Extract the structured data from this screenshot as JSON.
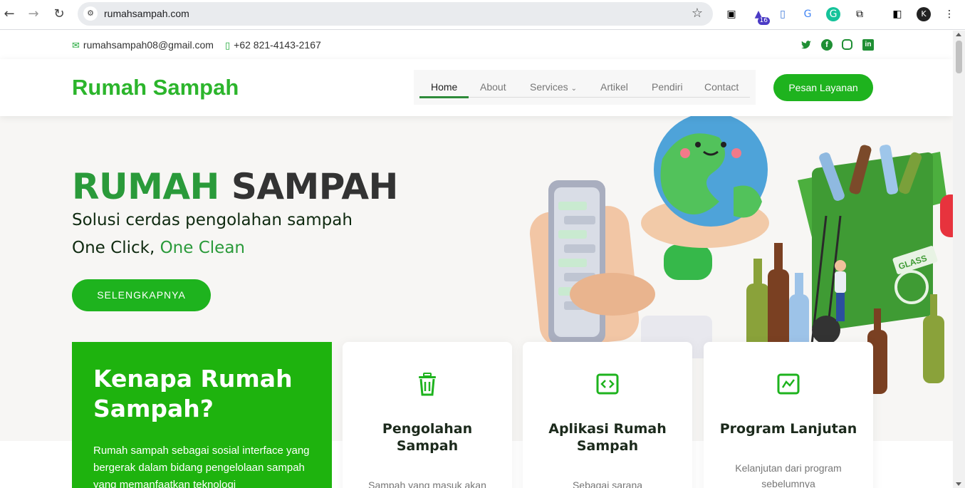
{
  "browser": {
    "url": "rumahsampah.com",
    "extension_badge": "16"
  },
  "topbar": {
    "email": "rumahsampah08@gmail.com",
    "phone": "+62 821-4143-2167"
  },
  "header": {
    "logo": "Rumah Sampah",
    "menu": [
      "Home",
      "About",
      "Services",
      "Artikel",
      "Pendiri",
      "Contact"
    ],
    "cta": "Pesan Layanan"
  },
  "hero": {
    "title_accent": "RUMAH",
    "title_rest": "SAMPAH",
    "subtitle": "Solusi cerdas pengolahan sampah",
    "tagline_a": "One Click,",
    "tagline_b": "One Clean",
    "button": "SELENGKAPNYA"
  },
  "why": {
    "title": "Kenapa Rumah Sampah?",
    "text": "Rumah sampah sebagai sosial interface yang bergerak dalam bidang pengelolaan sampah yang memanfaatkan teknologi"
  },
  "services": [
    {
      "icon": "trash-icon",
      "title": "Pengolahan Sampah",
      "text": "Sampah yang masuk akan"
    },
    {
      "icon": "code-icon",
      "title": "Aplikasi Rumah Sampah",
      "text": "Sebagai sarana"
    },
    {
      "icon": "chart-icon",
      "title": "Program Lanjutan",
      "text": "Kelanjutan dari program sebelumnya"
    }
  ],
  "colors": {
    "brand_green": "#1eb31e",
    "dark_green": "#2a9a3a"
  }
}
